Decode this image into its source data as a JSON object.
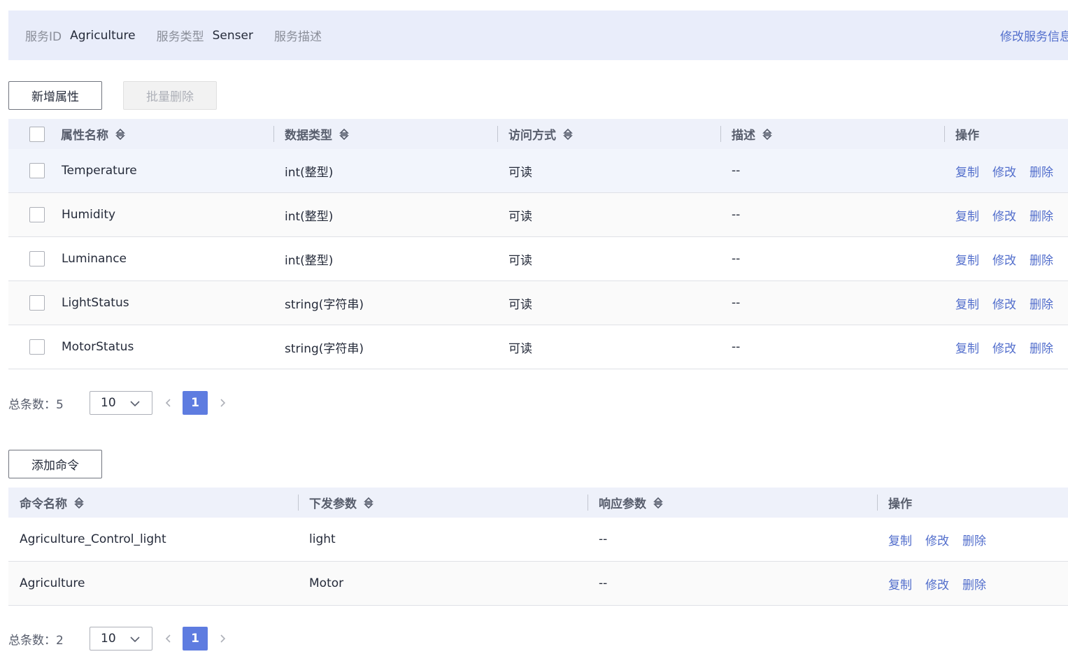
{
  "service_info": {
    "id_label": "服务ID",
    "id_value": "Agriculture",
    "type_label": "服务类型",
    "type_value": "Senser",
    "desc_label": "服务描述",
    "desc_value": "",
    "edit_link": "修改服务信息"
  },
  "properties": {
    "add_button": "新增属性",
    "batch_delete_button": "批量删除",
    "columns": [
      "属性名称",
      "数据类型",
      "访问方式",
      "描述",
      "操作"
    ],
    "rows": [
      {
        "name": "Temperature",
        "type": "int(整型)",
        "access": "可读",
        "desc": "--"
      },
      {
        "name": "Humidity",
        "type": "int(整型)",
        "access": "可读",
        "desc": "--"
      },
      {
        "name": "Luminance",
        "type": "int(整型)",
        "access": "可读",
        "desc": "--"
      },
      {
        "name": "LightStatus",
        "type": "string(字符串)",
        "access": "可读",
        "desc": "--"
      },
      {
        "name": "MotorStatus",
        "type": "string(字符串)",
        "access": "可读",
        "desc": "--"
      }
    ],
    "actions": {
      "copy": "复制",
      "edit": "修改",
      "delete": "删除"
    },
    "pager": {
      "total": "总条数：5",
      "page_size": "10",
      "current_page": "1"
    }
  },
  "commands": {
    "add_button": "添加命令",
    "columns": [
      "命令名称",
      "下发参数",
      "响应参数",
      "操作"
    ],
    "rows": [
      {
        "name": "Agriculture_Control_light",
        "params": "light",
        "response": "--"
      },
      {
        "name": "Agriculture",
        "params": "Motor",
        "response": "--"
      }
    ],
    "actions": {
      "copy": "复制",
      "edit": "修改",
      "delete": "删除"
    },
    "pager": {
      "total": "总条数：2",
      "page_size": "10",
      "current_page": "1"
    }
  },
  "colors": {
    "link": "#526ecc",
    "primary": "#5e7ce0",
    "header_bg": "#eef1fa",
    "info_bg": "#e9edfa"
  }
}
